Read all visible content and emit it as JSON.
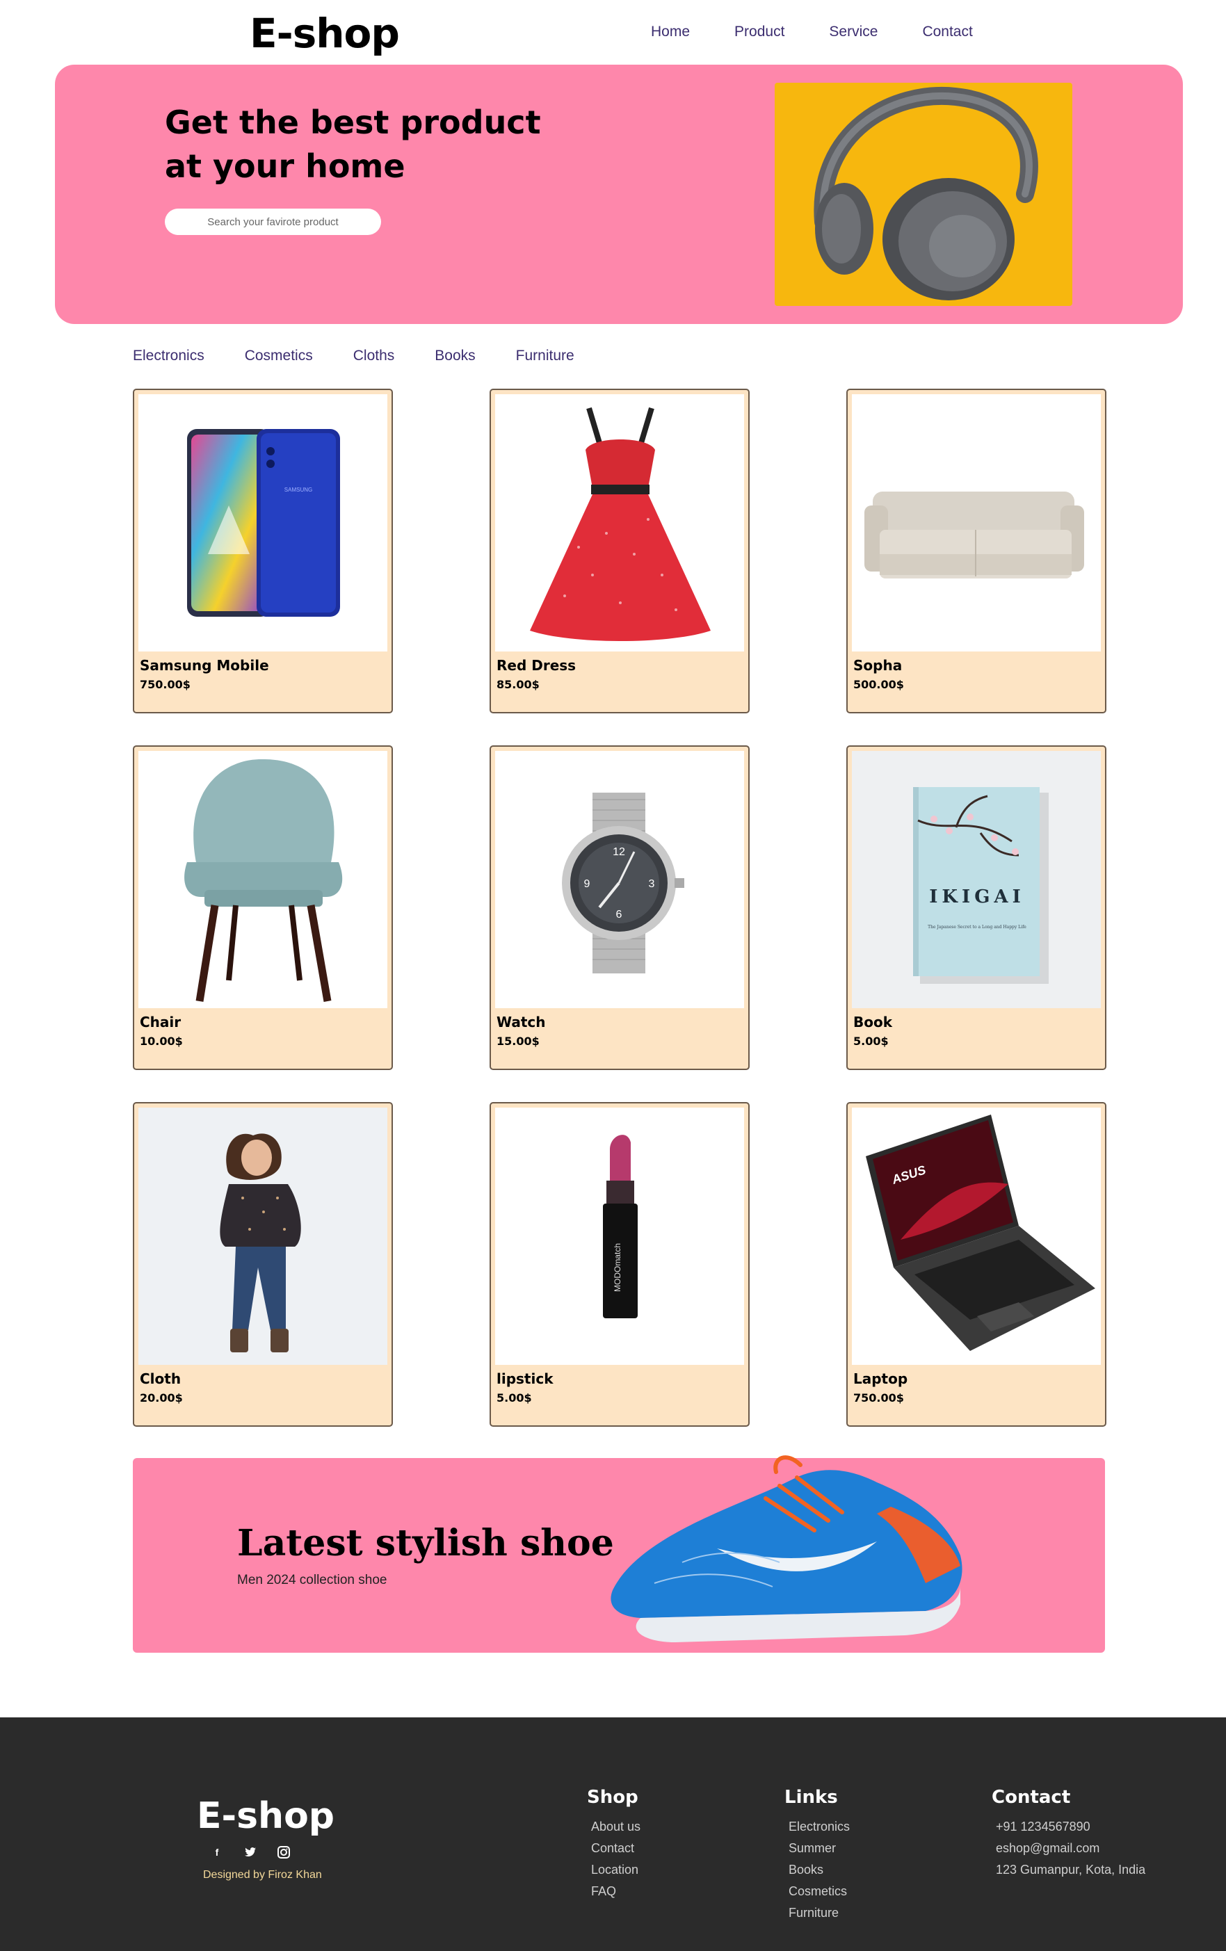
{
  "header": {
    "brand": "E-shop",
    "nav": [
      "Home",
      "Product",
      "Service",
      "Contact"
    ]
  },
  "hero": {
    "title": "Get the best product at your home",
    "search_placeholder": "Search your favirote product",
    "bg_color": "#fe87ab"
  },
  "categories": [
    "Electronics",
    "Cosmetics",
    "Cloths",
    "Books",
    "Furniture"
  ],
  "products": [
    {
      "name": "Samsung Mobile",
      "price": "750.00$",
      "icon": "phone-image"
    },
    {
      "name": "Red Dress",
      "price": "85.00$",
      "icon": "dress-image"
    },
    {
      "name": "Sopha",
      "price": "500.00$",
      "icon": "sofa-image"
    },
    {
      "name": "Chair",
      "price": "10.00$",
      "icon": "chair-image"
    },
    {
      "name": "Watch",
      "price": "15.00$",
      "icon": "watch-image"
    },
    {
      "name": "Book",
      "price": "5.00$",
      "icon": "book-image"
    },
    {
      "name": "Cloth",
      "price": "20.00$",
      "icon": "woman-image"
    },
    {
      "name": "lipstick",
      "price": "5.00$",
      "icon": "lipstick-image"
    },
    {
      "name": "Laptop",
      "price": "750.00$",
      "icon": "laptop-image"
    }
  ],
  "promo": {
    "title": "Latest stylish shoe",
    "subtitle": "Men 2024 collection shoe"
  },
  "book_cover": {
    "title": "IKIGAI",
    "subtitle": "The Japanese Secret to a Long and Happy Life"
  },
  "footer": {
    "brand": "E-shop",
    "social_icons": [
      "facebook-icon",
      "twitter-icon",
      "instagram-icon"
    ],
    "credit": "Designed by Firoz Khan",
    "shop": {
      "title": "Shop",
      "links": [
        "About us",
        "Contact",
        "Location",
        "FAQ"
      ]
    },
    "links": {
      "title": "Links",
      "links": [
        "Electronics",
        "Summer",
        "Books",
        "Cosmetics",
        "Furniture"
      ]
    },
    "contact": {
      "title": "Contact",
      "links": [
        "+91 1234567890",
        "eshop@gmail.com",
        "123 Gumanpur, Kota, India"
      ]
    }
  }
}
